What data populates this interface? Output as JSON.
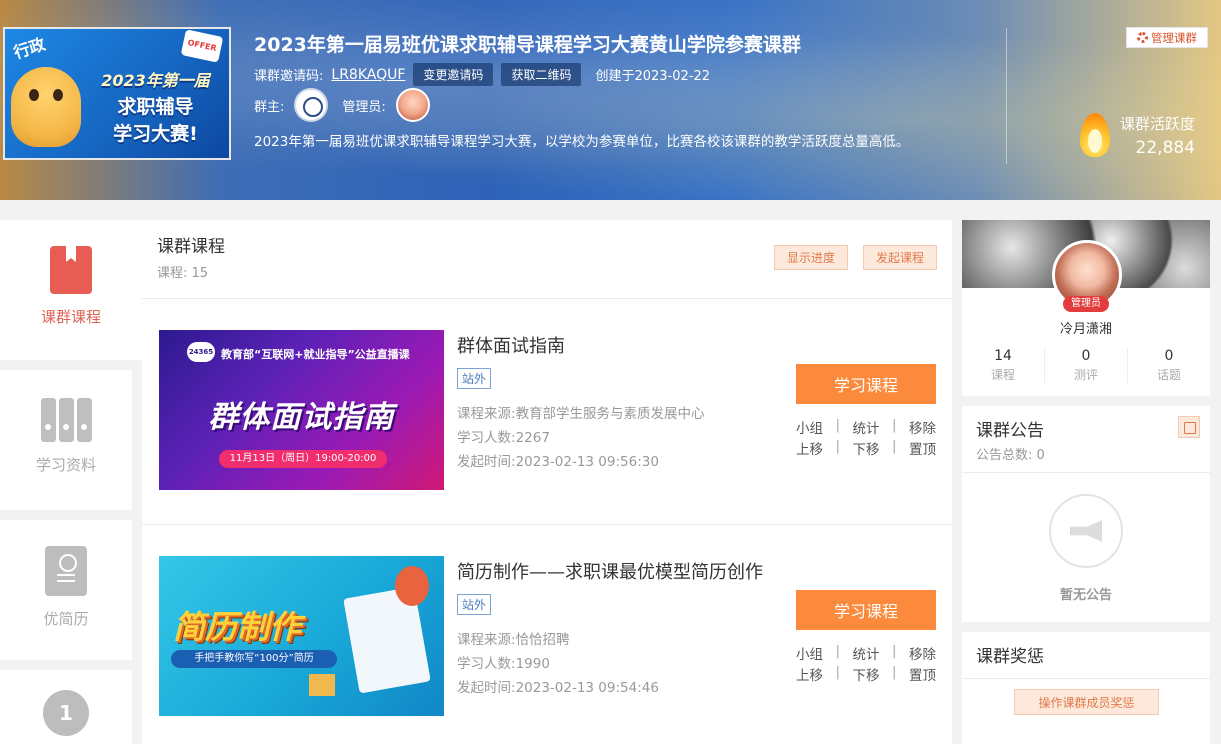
{
  "header": {
    "cover": {
      "tag": "行政",
      "offer": "OFFER",
      "line1": "2023年第一届",
      "line2": "求职辅导",
      "line3": "学习大赛!"
    },
    "title": "2023年第一届易班优课求职辅导课程学习大赛黄山学院参赛课群",
    "invite_label": "课群邀请码:",
    "invite_code": "LR8KAQUF",
    "change_code_label": "变更邀请码",
    "qr_label": "获取二维码",
    "created": "创建于2023-02-22",
    "owner_label": "群主:",
    "admin_label": "管理员:",
    "description": "2023年第一届易班优课求职辅导课程学习大赛，以学校为参赛单位，比赛各校该课群的教学活跃度总量高低。",
    "manage_label": "管理课群",
    "activity_label": "课群活跃度",
    "activity_value": "22,884"
  },
  "nav": {
    "items": [
      {
        "label": "课群课程",
        "icon": "book-icon",
        "active": true
      },
      {
        "label": "学习资料",
        "icon": "binders-icon",
        "active": false
      },
      {
        "label": "优简历",
        "icon": "resume-icon",
        "active": false
      },
      {
        "label": "",
        "icon": "medal-icon",
        "active": false
      }
    ],
    "medal_number": "1"
  },
  "courses_section": {
    "title": "课群课程",
    "count_label": "课程:",
    "count": "15",
    "show_progress_label": "显示进度",
    "start_course_label": "发起课程",
    "source_label": "课程来源:",
    "learners_label": "学习人数:",
    "time_label": "发起时间:",
    "study_label": "学习课程",
    "ops_row1": [
      "小组",
      "统计",
      "移除"
    ],
    "ops_row2": [
      "上移",
      "下移",
      "置顶"
    ],
    "items": [
      {
        "title": "群体面试指南",
        "tag": "站外",
        "source": "教育部学生服务与素质发展中心",
        "learners": "2267",
        "time": "2023-02-13 09:56:30",
        "thumb": {
          "badge": "24365",
          "top": "教育部“互联网+就业指导”公益直播课",
          "big": "群体面试指南",
          "bar": "11月13日（周日）19:00-20:00"
        }
      },
      {
        "title": "简历制作——求职课最优模型简历创作",
        "tag": "站外",
        "source": "恰恰招聘",
        "learners": "1990",
        "time": "2023-02-13 09:54:46",
        "thumb": {
          "big": "简历制作",
          "sub": "手把手教你写“100分”简历"
        }
      }
    ]
  },
  "profile": {
    "role": "管理员",
    "name": "冷月潇湘",
    "stats": [
      {
        "value": "14",
        "label": "课程"
      },
      {
        "value": "0",
        "label": "测评"
      },
      {
        "value": "0",
        "label": "话题"
      }
    ]
  },
  "notice": {
    "title": "课群公告",
    "count_label": "公告总数:",
    "count": "0",
    "empty": "暂无公告"
  },
  "reward": {
    "title": "课群奖惩",
    "button": "操作课群成员奖惩"
  },
  "colors": {
    "accent": "#fb8a3c",
    "nav_active": "#e06155",
    "tag_blue": "#4a7dbf"
  }
}
